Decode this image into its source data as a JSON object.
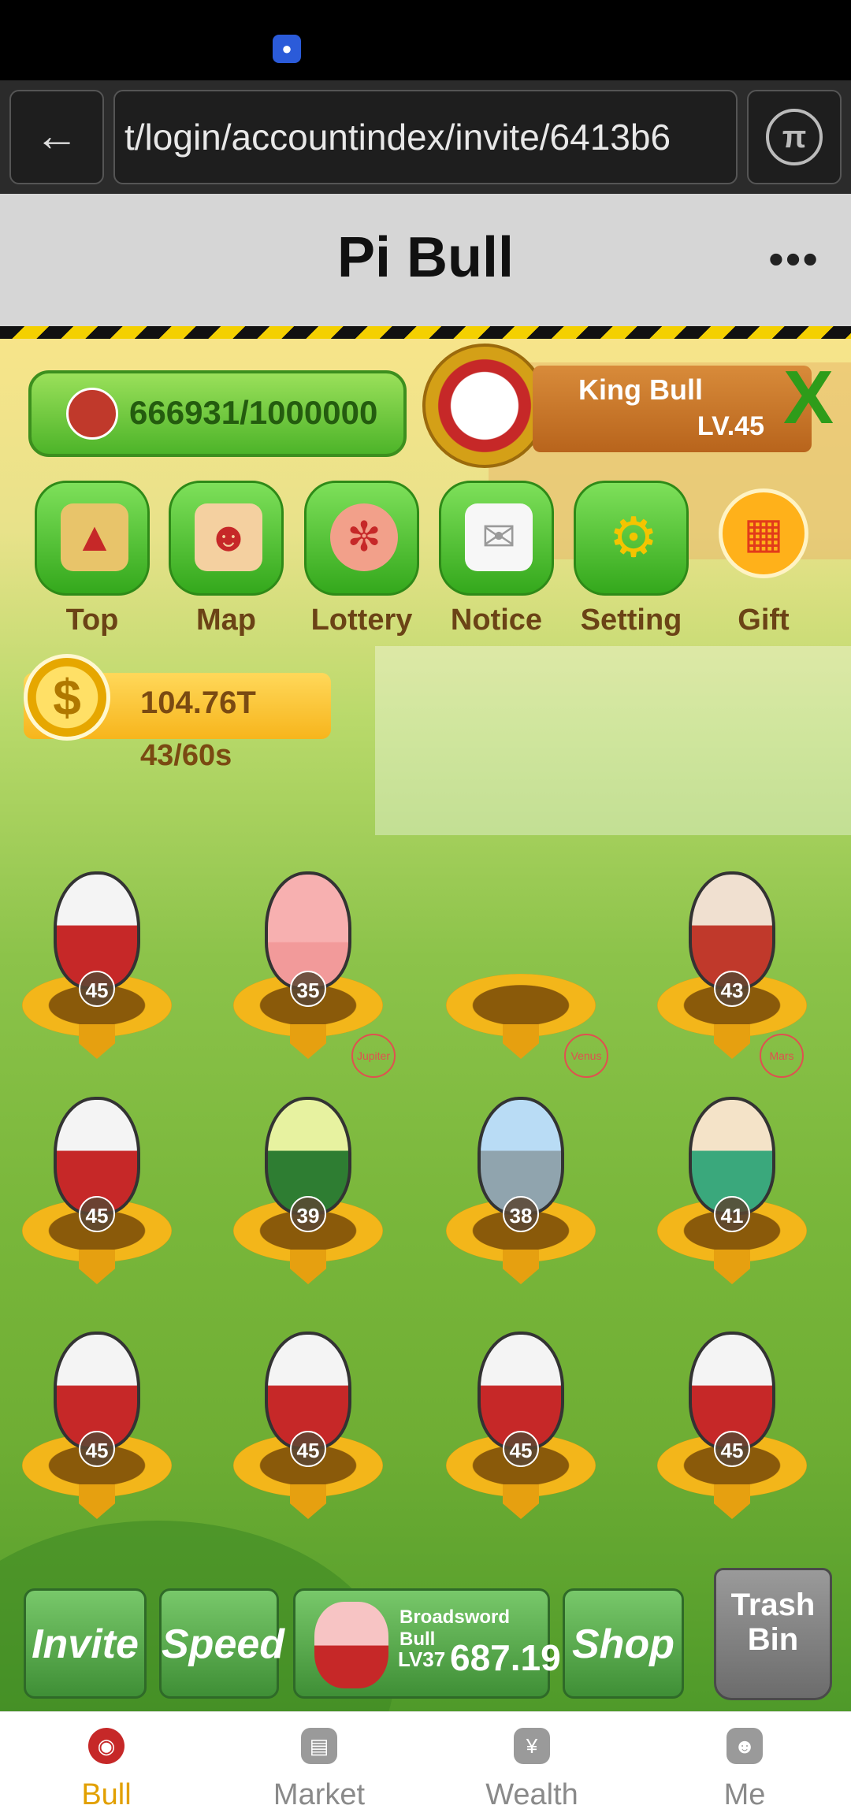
{
  "status": {
    "notification_icon": "lightbulb-icon"
  },
  "browser": {
    "url": "t/login/accountindex/invite/6413b6",
    "back_icon": "arrow-left-icon",
    "pi_icon": "pi-icon",
    "pi_glyph": "π"
  },
  "header": {
    "title": "Pi Bull",
    "more_label": "•••"
  },
  "game": {
    "progress_text": "666931/1000000",
    "king": {
      "name": "King Bull",
      "level": "LV.45"
    },
    "menu": [
      {
        "label": "Top",
        "icon": "podium-icon"
      },
      {
        "label": "Map",
        "icon": "bull-map-icon"
      },
      {
        "label": "Lottery",
        "icon": "wheel-icon"
      },
      {
        "label": "Notice",
        "icon": "envelope-icon"
      },
      {
        "label": "Setting",
        "icon": "gear-icon"
      },
      {
        "label": "Gift",
        "icon": "gift-icon"
      }
    ],
    "coin": {
      "value": "104.76T",
      "timer": "43/60s",
      "symbol": "$"
    },
    "grid": [
      {
        "level": "45"
      },
      {
        "level": "35"
      },
      {
        "level": ""
      },
      {
        "level": "43"
      },
      {
        "level": "45"
      },
      {
        "level": "39",
        "planet": "Jupiter"
      },
      {
        "level": "38",
        "planet": "Venus"
      },
      {
        "level": "41",
        "planet": "Mars"
      },
      {
        "level": "45"
      },
      {
        "level": "45"
      },
      {
        "level": "45"
      },
      {
        "level": "45"
      }
    ],
    "bottom": {
      "invite": "Invite",
      "speed": "Speed",
      "buy": {
        "name": "Broadsword Bull",
        "level": "LV37",
        "price": "687.19"
      },
      "shop": "Shop",
      "trash": "Trash\nBin"
    }
  },
  "tabs": [
    {
      "label": "Bull",
      "icon": "bull-icon",
      "active": true
    },
    {
      "label": "Market",
      "icon": "store-icon",
      "active": false
    },
    {
      "label": "Wealth",
      "icon": "money-bag-icon",
      "active": false
    },
    {
      "label": "Me",
      "icon": "face-icon",
      "active": false
    }
  ],
  "colors": {
    "accent": "#e2a000",
    "game_green": "#4db429",
    "coin_gold": "#f7b51c"
  }
}
